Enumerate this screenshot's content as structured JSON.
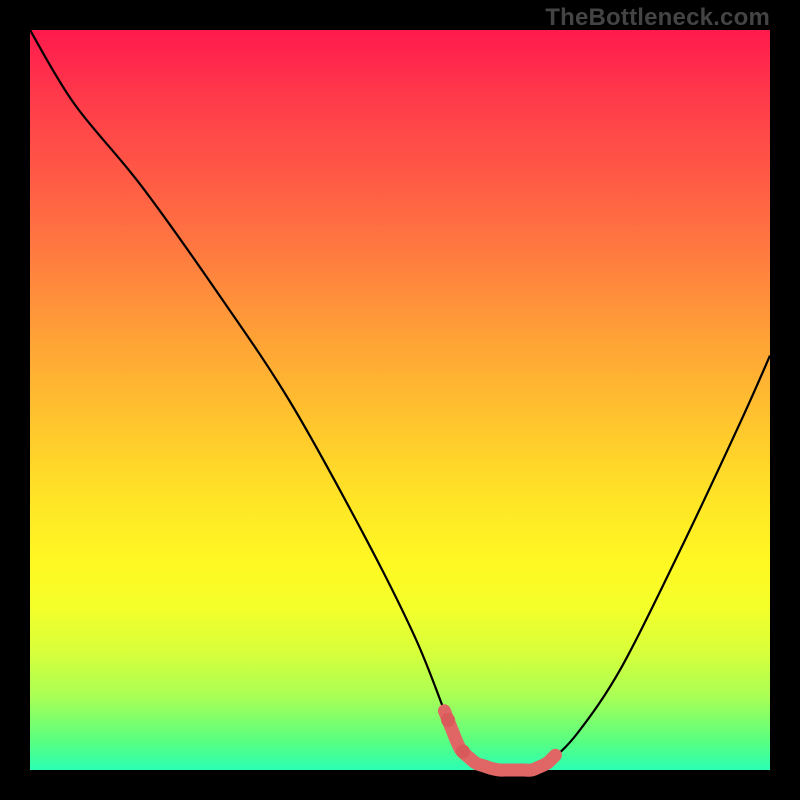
{
  "watermark": {
    "text": "TheBottleneck.com"
  },
  "colors": {
    "curve": "#000000",
    "highlight": "#e06666",
    "highlight_dot": "#d85a5a",
    "background_black": "#000000"
  },
  "chart_data": {
    "type": "line",
    "title": "",
    "xlabel": "",
    "ylabel": "",
    "xlim": [
      0,
      100
    ],
    "ylim": [
      0,
      100
    ],
    "grid": false,
    "legend": false,
    "series": [
      {
        "name": "curve",
        "x": [
          0,
          6,
          15,
          25,
          35,
          45,
          52,
          56,
          58,
          60,
          63,
          66,
          68,
          70,
          74,
          80,
          88,
          96,
          100
        ],
        "y": [
          100,
          90,
          79,
          65,
          50,
          32,
          18,
          8,
          3,
          1,
          0,
          0,
          0,
          1,
          5,
          14,
          30,
          47,
          56
        ]
      }
    ],
    "highlight_region": {
      "x_start": 56,
      "x_end": 71
    },
    "highlight_dots_x": [
      56.5,
      58.5
    ]
  }
}
